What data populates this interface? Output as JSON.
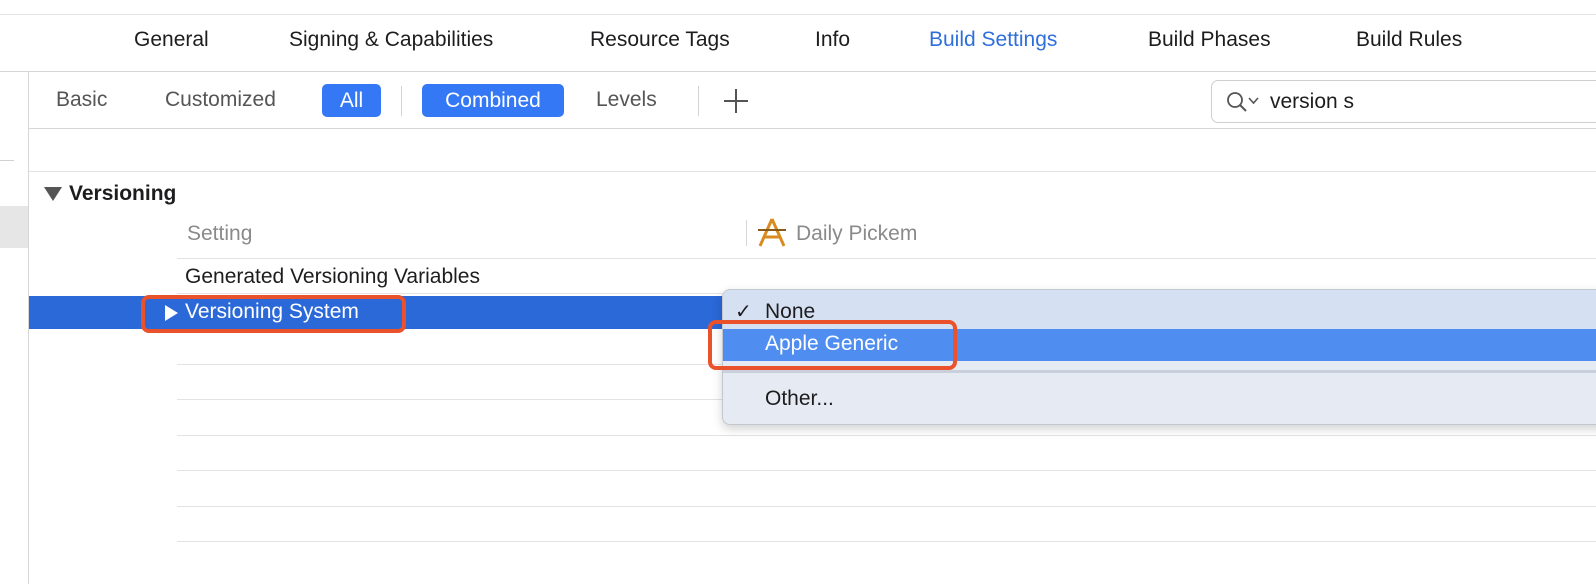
{
  "tabs": [
    {
      "label": "General",
      "active": false
    },
    {
      "label": "Signing & Capabilities",
      "active": false
    },
    {
      "label": "Resource Tags",
      "active": false
    },
    {
      "label": "Info",
      "active": false
    },
    {
      "label": "Build Settings",
      "active": true
    },
    {
      "label": "Build Phases",
      "active": false
    },
    {
      "label": "Build Rules",
      "active": false
    }
  ],
  "filter_bar": {
    "basic": "Basic",
    "customized": "Customized",
    "all": "All",
    "combined": "Combined",
    "levels": "Levels",
    "add_icon": "plus-icon"
  },
  "search": {
    "value": "version s",
    "icon": "magnifier-icon"
  },
  "section": {
    "title": "Versioning",
    "expanded": true
  },
  "columns": {
    "setting": "Setting",
    "target": "Daily Pickem"
  },
  "rows": [
    {
      "label": "Generated Versioning Variables",
      "selected": false
    },
    {
      "label": "Versioning System",
      "selected": true
    }
  ],
  "popup": {
    "items": [
      {
        "label": "None",
        "checked": true
      },
      {
        "label": "Apple Generic",
        "highlighted": true
      },
      {
        "label": "Other..."
      }
    ],
    "check_glyph": "✓"
  },
  "colors": {
    "accent": "#3478f6",
    "selection": "#2b68d8",
    "annotation": "#e9522b",
    "active_tab": "#2f6fdb"
  }
}
